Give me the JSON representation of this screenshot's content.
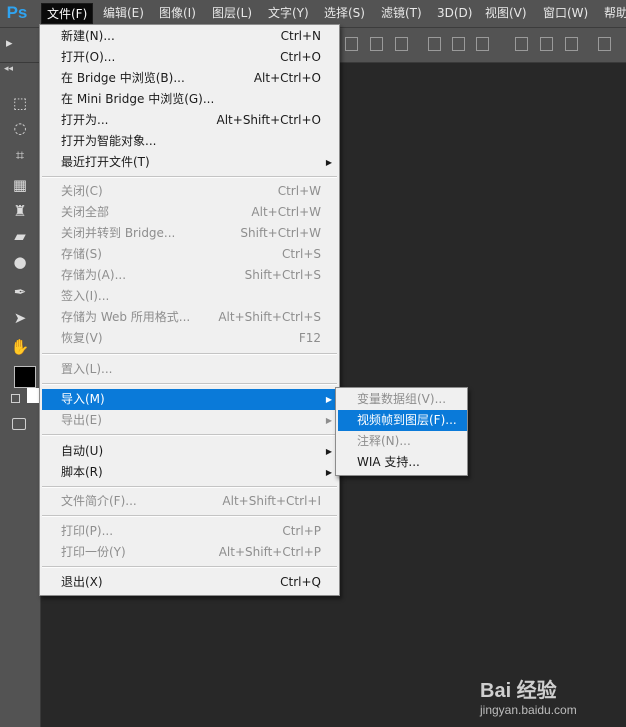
{
  "app": {
    "logo": "Ps"
  },
  "menubar": {
    "items": [
      {
        "label": "文件(F)"
      },
      {
        "label": "编辑(E)"
      },
      {
        "label": "图像(I)"
      },
      {
        "label": "图层(L)"
      },
      {
        "label": "文字(Y)"
      },
      {
        "label": "选择(S)"
      },
      {
        "label": "滤镜(T)"
      },
      {
        "label": "3D(D)"
      },
      {
        "label": "视图(V)"
      },
      {
        "label": "窗口(W)"
      },
      {
        "label": "帮助"
      }
    ]
  },
  "file_menu": {
    "items": [
      {
        "label": "新建(N)...",
        "shortcut": "Ctrl+N"
      },
      {
        "label": "打开(O)...",
        "shortcut": "Ctrl+O"
      },
      {
        "label": "在 Bridge 中浏览(B)...",
        "shortcut": "Alt+Ctrl+O"
      },
      {
        "label": "在 Mini Bridge 中浏览(G)..."
      },
      {
        "label": "打开为...",
        "shortcut": "Alt+Shift+Ctrl+O"
      },
      {
        "label": "打开为智能对象..."
      },
      {
        "label": "最近打开文件(T)",
        "submenu_arrow": "▶"
      },
      {
        "label": "关闭(C)",
        "shortcut": "Ctrl+W"
      },
      {
        "label": "关闭全部",
        "shortcut": "Alt+Ctrl+W"
      },
      {
        "label": "关闭并转到 Bridge...",
        "shortcut": "Shift+Ctrl+W"
      },
      {
        "label": "存储(S)",
        "shortcut": "Ctrl+S"
      },
      {
        "label": "存储为(A)...",
        "shortcut": "Shift+Ctrl+S"
      },
      {
        "label": "签入(I)..."
      },
      {
        "label": "存储为 Web 所用格式...",
        "shortcut": "Alt+Shift+Ctrl+S"
      },
      {
        "label": "恢复(V)",
        "shortcut": "F12"
      },
      {
        "label": "置入(L)..."
      },
      {
        "label": "导入(M)",
        "submenu_arrow": "▶"
      },
      {
        "label": "导出(E)",
        "submenu_arrow": "▶"
      },
      {
        "label": "自动(U)",
        "submenu_arrow": "▶"
      },
      {
        "label": "脚本(R)",
        "submenu_arrow": "▶"
      },
      {
        "label": "文件简介(F)...",
        "shortcut": "Alt+Shift+Ctrl+I"
      },
      {
        "label": "打印(P)...",
        "shortcut": "Ctrl+P"
      },
      {
        "label": "打印一份(Y)",
        "shortcut": "Alt+Shift+Ctrl+P"
      },
      {
        "label": "退出(X)",
        "shortcut": "Ctrl+Q"
      }
    ]
  },
  "import_submenu": {
    "items": [
      {
        "label": "变量数据组(V)..."
      },
      {
        "label": "视频帧到图层(F)..."
      },
      {
        "label": "注释(N)..."
      },
      {
        "label": "WIA 支持..."
      }
    ]
  },
  "colors": {
    "highlight": "#0a7ad9",
    "logo": "#2fa3f0",
    "foreground_swatch": "#000000",
    "background_swatch": "#ffffff"
  },
  "watermark": {
    "text": "Bai 经验",
    "url_text": "jingyan.baidu.com"
  }
}
